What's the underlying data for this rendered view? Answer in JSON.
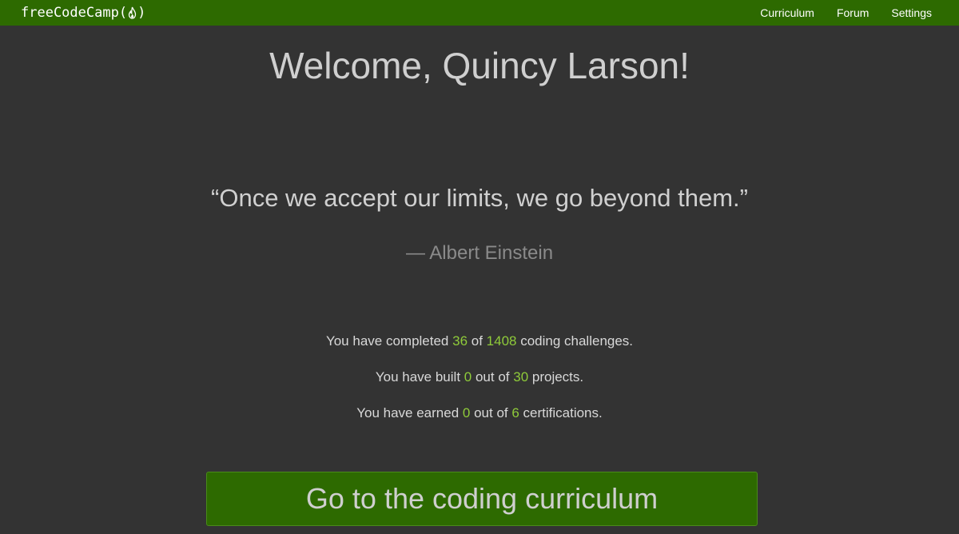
{
  "navbar": {
    "brand_left": "freeCodeCamp(",
    "brand_right": ")",
    "brand_icon": "flame-icon",
    "links": [
      {
        "label": "Curriculum"
      },
      {
        "label": "Forum"
      },
      {
        "label": "Settings"
      }
    ],
    "background_color": "#2d6a00"
  },
  "main": {
    "welcome": "Welcome, Quincy Larson!",
    "quote": "“Once we accept our limits, we go beyond them.”",
    "author": "— Albert Einstein",
    "stats": {
      "challenges": {
        "prefix": "You have completed ",
        "completed": "36",
        "middle": " of ",
        "total": "1408",
        "suffix": " coding challenges."
      },
      "projects": {
        "prefix": "You have built ",
        "completed": "0",
        "middle": " out of ",
        "total": "30",
        "suffix": " projects."
      },
      "certifications": {
        "prefix": "You have earned ",
        "completed": "0",
        "middle": " out of ",
        "total": "6",
        "suffix": " certifications."
      }
    },
    "cta_label": "Go to the coding curriculum"
  },
  "colors": {
    "accent_green": "#8fcb3a",
    "page_background": "#333333"
  }
}
